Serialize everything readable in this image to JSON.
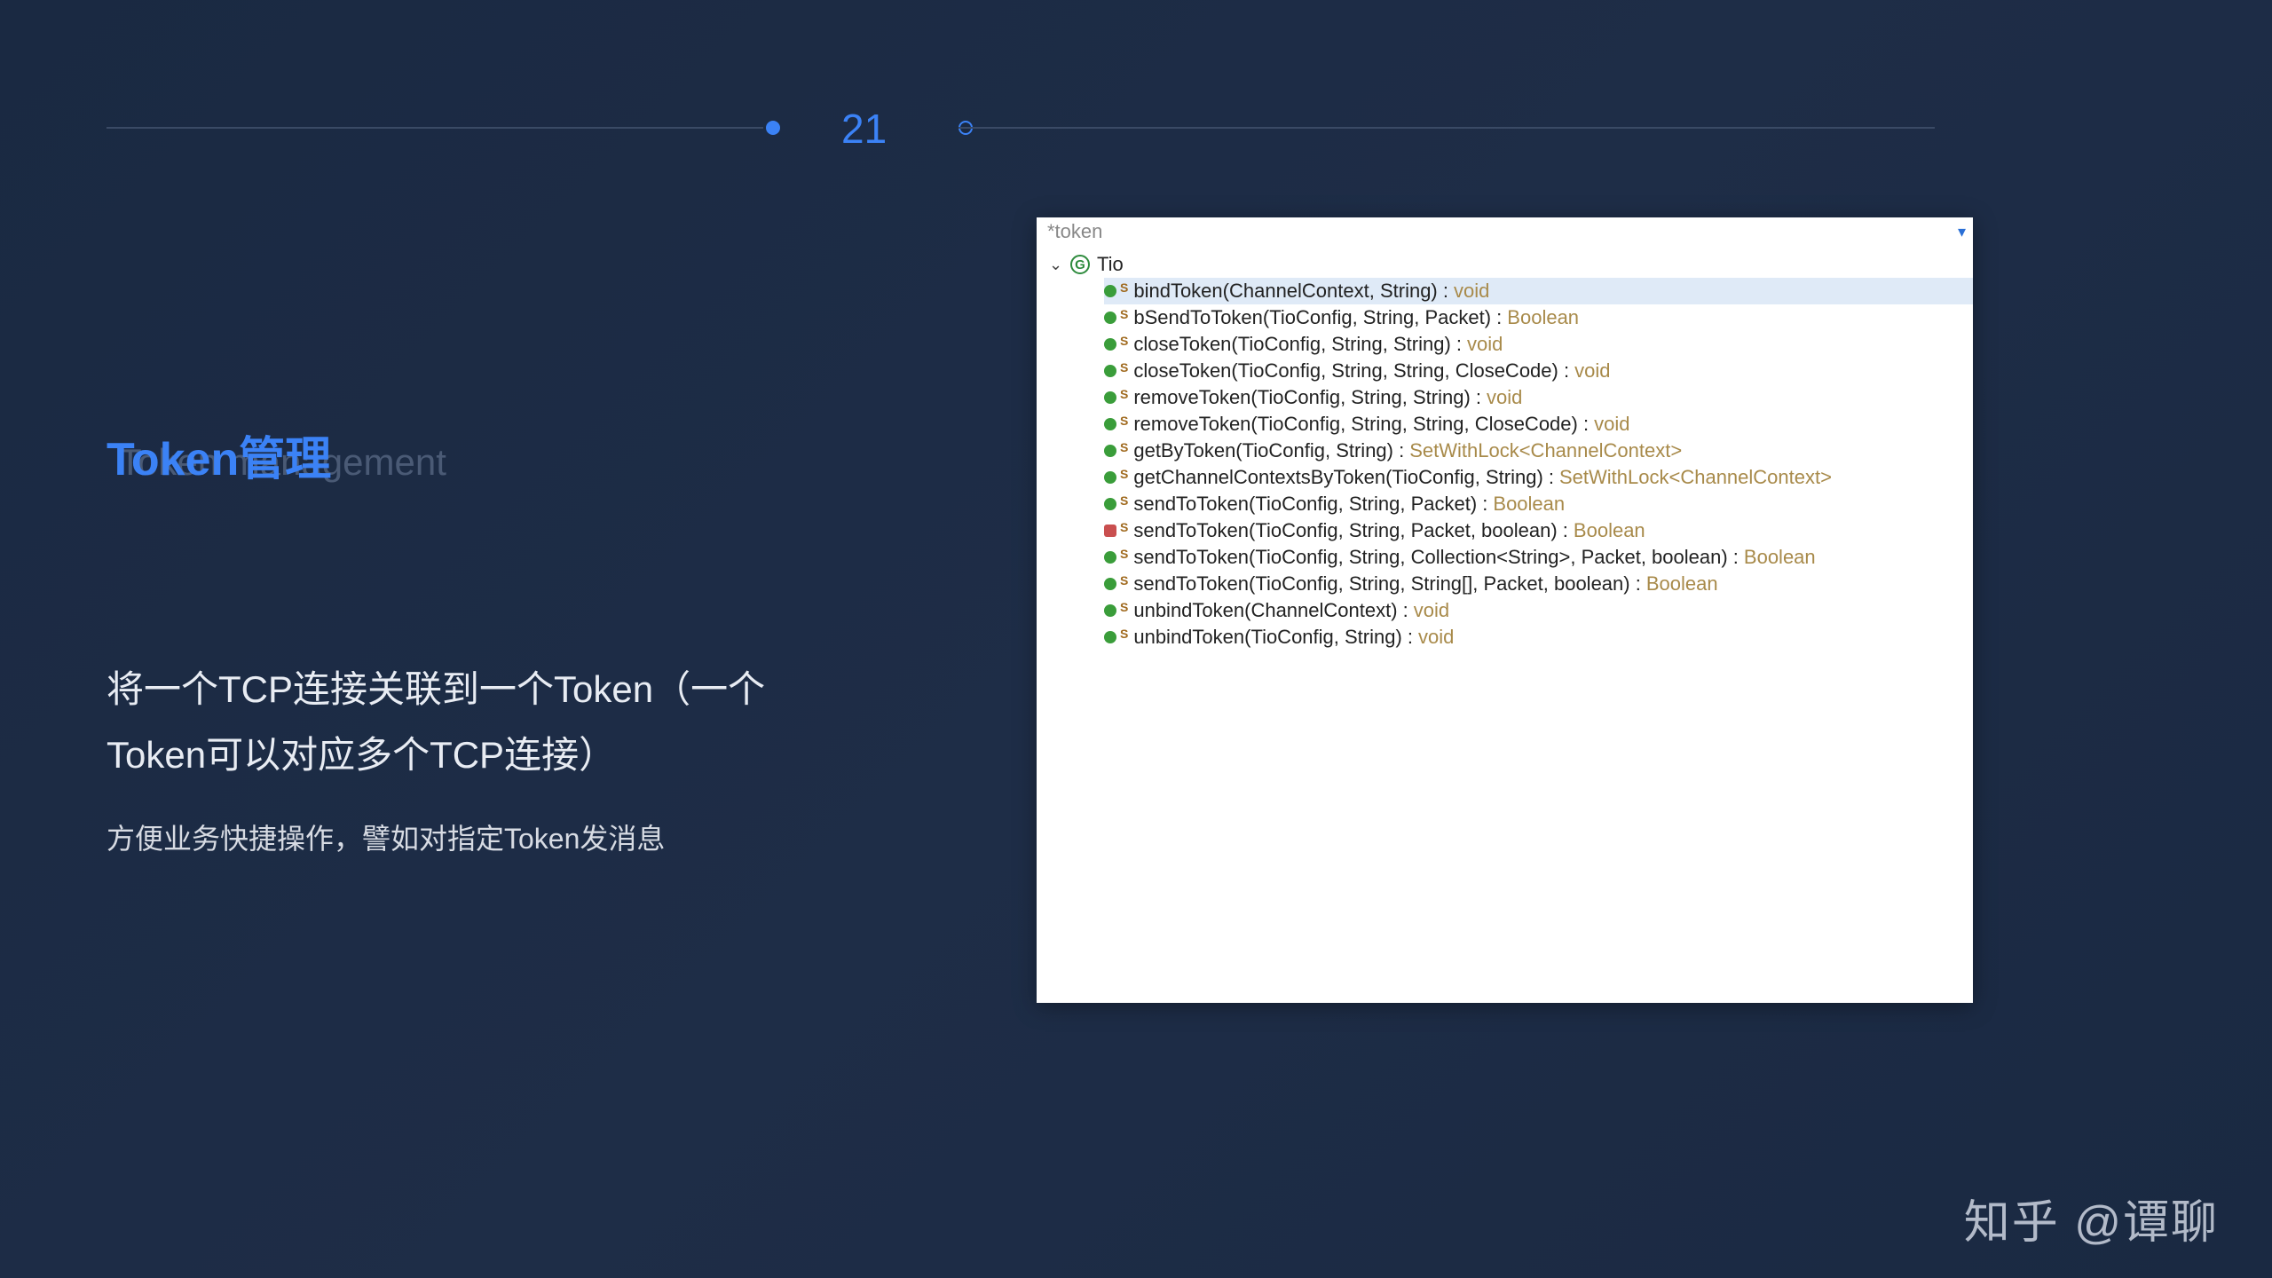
{
  "slide": {
    "number": "21"
  },
  "title": {
    "cn": "Token管理",
    "en": "Token management"
  },
  "desc": {
    "main": "将一个TCP连接关联到一个Token（一个Token可以对应多个TCP连接）",
    "sub": "方便业务快捷操作，譬如对指定Token发消息"
  },
  "code": {
    "filter": "*token",
    "dropdown_glyph": "▾",
    "class_name": "Tio",
    "static_badge": "S",
    "class_glyph": "G",
    "methods": [
      {
        "vis": "pub",
        "sig": "bindToken(ChannelContext, String)",
        "ret": "void",
        "selected": true
      },
      {
        "vis": "pub",
        "sig": "bSendToToken(TioConfig, String, Packet)",
        "ret": "Boolean"
      },
      {
        "vis": "pub",
        "sig": "closeToken(TioConfig, String, String)",
        "ret": "void"
      },
      {
        "vis": "pub",
        "sig": "closeToken(TioConfig, String, String, CloseCode)",
        "ret": "void"
      },
      {
        "vis": "pub",
        "sig": "removeToken(TioConfig, String, String)",
        "ret": "void"
      },
      {
        "vis": "pub",
        "sig": "removeToken(TioConfig, String, String, CloseCode)",
        "ret": "void"
      },
      {
        "vis": "pub",
        "sig": "getByToken(TioConfig, String)",
        "ret": "SetWithLock<ChannelContext>"
      },
      {
        "vis": "pub",
        "sig": "getChannelContextsByToken(TioConfig, String)",
        "ret": "SetWithLock<ChannelContext>"
      },
      {
        "vis": "pub",
        "sig": "sendToToken(TioConfig, String, Packet)",
        "ret": "Boolean"
      },
      {
        "vis": "priv",
        "sig": "sendToToken(TioConfig, String, Packet, boolean)",
        "ret": "Boolean"
      },
      {
        "vis": "pub",
        "sig": "sendToToken(TioConfig, String, Collection<String>, Packet, boolean)",
        "ret": "Boolean"
      },
      {
        "vis": "pub",
        "sig": "sendToToken(TioConfig, String, String[], Packet, boolean)",
        "ret": "Boolean"
      },
      {
        "vis": "pub",
        "sig": "unbindToken(ChannelContext)",
        "ret": "void"
      },
      {
        "vis": "pub",
        "sig": "unbindToken(TioConfig, String)",
        "ret": "void"
      }
    ]
  },
  "watermark": "知乎 @谭聊"
}
